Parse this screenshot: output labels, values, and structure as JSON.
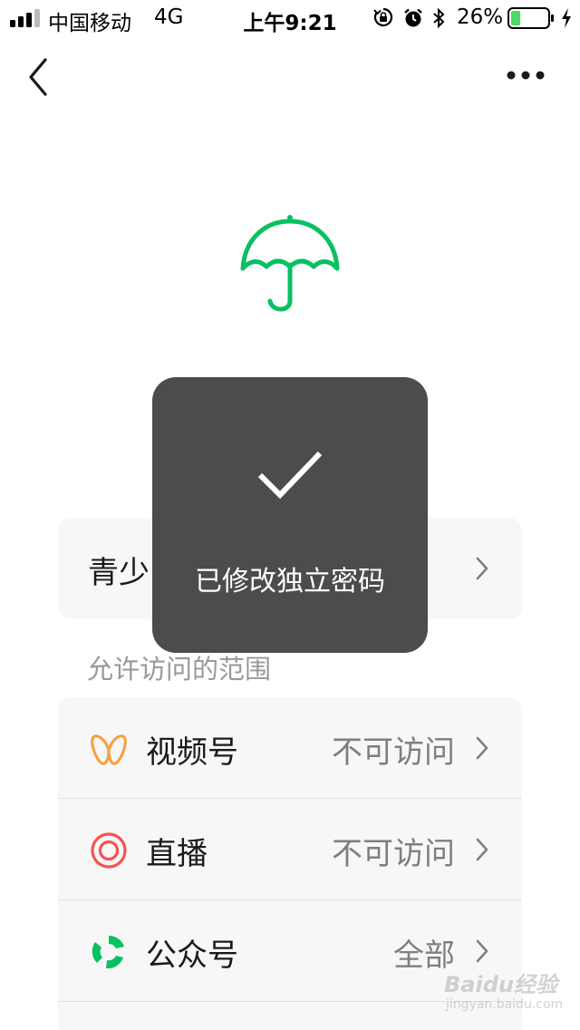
{
  "status_bar": {
    "carrier": "中国移动",
    "network": "4G",
    "time": "上午9:21",
    "battery_percent": "26%",
    "battery_level": 0.26,
    "icons": [
      "signal-icon",
      "rotation-lock-icon",
      "alarm-icon",
      "bluetooth-icon",
      "battery-icon",
      "charging-icon"
    ]
  },
  "nav": {
    "back_icon": "back-chevron-icon",
    "more_icon": "more-dots-icon"
  },
  "header_icon": "umbrella-icon",
  "top_card": {
    "title": "青少"
  },
  "section_label": "允许访问的范围",
  "access_list": [
    {
      "icon": "channels-icon",
      "label": "视频号",
      "value": "不可访问"
    },
    {
      "icon": "live-icon",
      "label": "直播",
      "value": "不可访问"
    },
    {
      "icon": "official-account-icon",
      "label": "公众号",
      "value": "全部"
    }
  ],
  "toast": {
    "icon": "checkmark-icon",
    "message": "已修改独立密码"
  },
  "watermark": {
    "logo": "Baidu经验",
    "sub": "jingyan.baidu.com"
  },
  "colors": {
    "accent_green": "#07c160",
    "channels_orange": "#fa9d3b",
    "live_red": "#fa5151",
    "toast_bg": "#4c4c4c"
  }
}
